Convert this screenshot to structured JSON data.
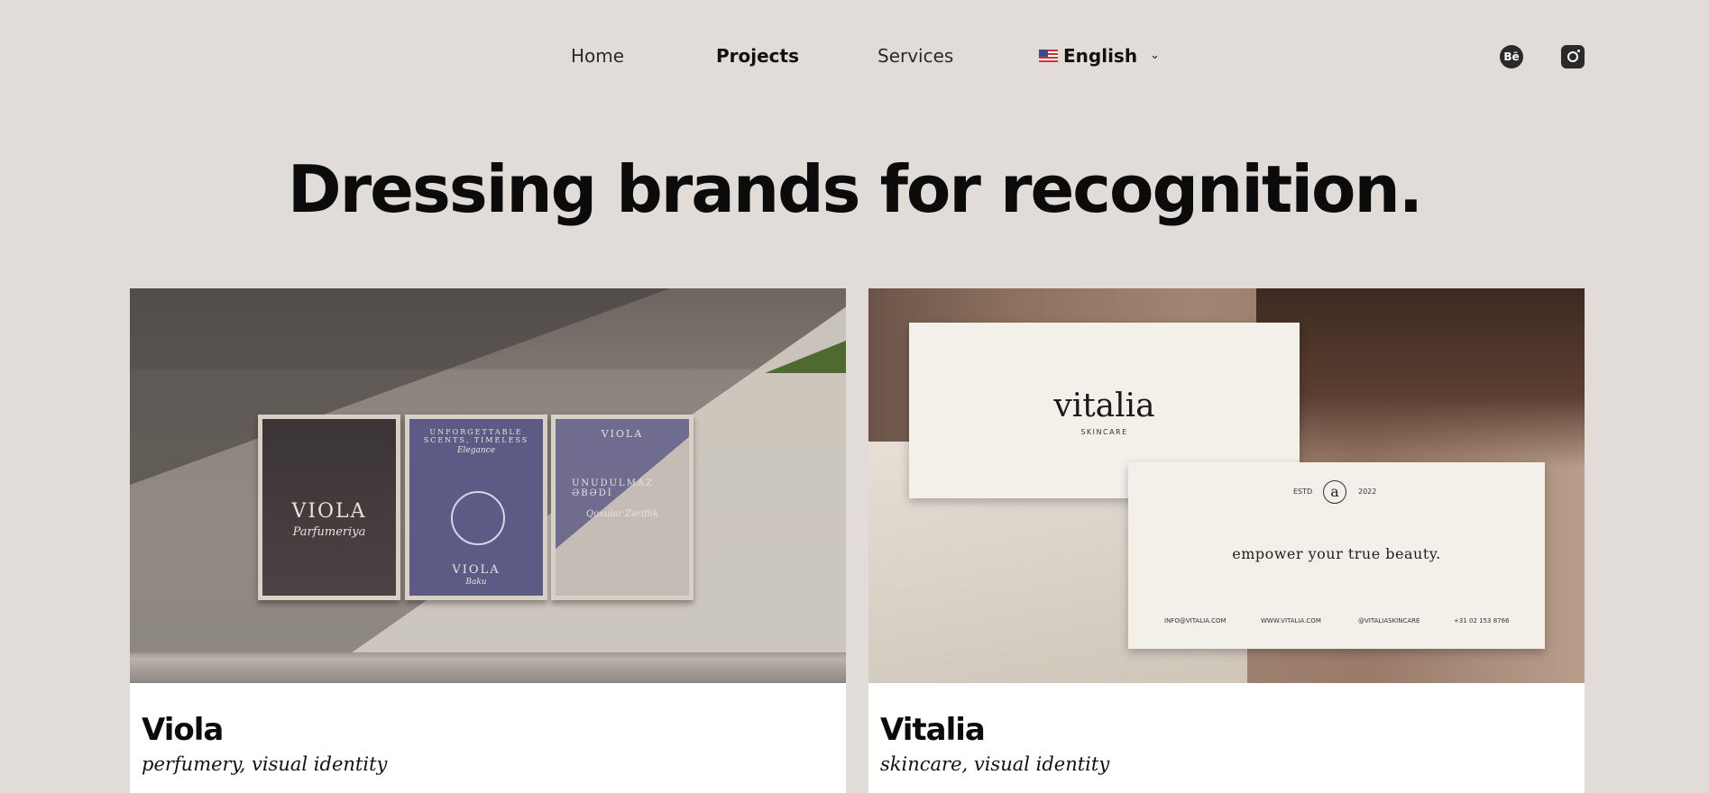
{
  "nav": {
    "items": [
      {
        "label": "Home",
        "active": false
      },
      {
        "label": "Projects",
        "active": true
      },
      {
        "label": "Services",
        "active": false
      }
    ],
    "language": {
      "label": "English",
      "flag_icon": "us-flag-icon",
      "chevron_icon": "chevron-down-icon"
    },
    "social": [
      {
        "name": "behance-icon",
        "glyph": "Bē"
      },
      {
        "name": "instagram-icon"
      }
    ]
  },
  "hero": {
    "title": "Dressing brands for recognition."
  },
  "projects": [
    {
      "title": "Viola",
      "subtitle": "perfumery, visual identity",
      "image": {
        "posters": [
          {
            "text_top": "",
            "brand": "VIOLA",
            "script": "Parfumeriya"
          },
          {
            "text_top": "UNFORGETTABLE SCENTS, TIMELESS",
            "script_top": "Elegance",
            "brand": "VIOLA",
            "script": "Baku"
          },
          {
            "text_top": "VIOLA",
            "headline": "UNUDULMAZ ƏBƏDİ",
            "script": "Qoxular Zəriflik"
          }
        ]
      }
    },
    {
      "title": "Vitalia",
      "subtitle": "skincare, visual identity",
      "image": {
        "logo": "vitalia",
        "logo_sub": "SKINCARE",
        "estd": "ESTD",
        "mark": "a",
        "year": "2022",
        "tagline": "empower your true beauty.",
        "contacts": [
          "INFO@VITALIA.COM",
          "WWW.VITALIA.COM",
          "@VITALIASKINCARE",
          "+31 02 153 8766"
        ]
      }
    }
  ],
  "colors": {
    "background": "#e2dcd8",
    "text": "#111111",
    "card": "#ffffff"
  }
}
